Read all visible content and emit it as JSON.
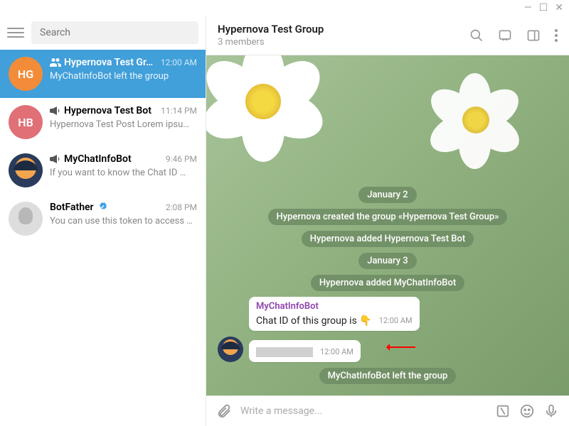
{
  "search": {
    "placeholder": "Search"
  },
  "chats": [
    {
      "name": "Hypernova Test Gr…",
      "time": "12:00 AM",
      "preview": "MyChatInfoBot left the group",
      "avatar_text": "HG"
    },
    {
      "name": "Hypernova Test Bot",
      "time": "11:14 PM",
      "preview": "Hypernova Test Post  Lorem ipsu…",
      "avatar_text": "HB"
    },
    {
      "name": "MyChatInfoBot",
      "time": "9:46 PM",
      "preview": "If you want to know the Chat ID …"
    },
    {
      "name": "BotFather",
      "time": "2:08 PM",
      "preview": "You can use this token to access …"
    }
  ],
  "header": {
    "title": "Hypernova Test Group",
    "sub": "3 members"
  },
  "timeline": {
    "date1": "January 2",
    "svc1": "Hypernova created the group «Hypernova Test Group»",
    "svc2": "Hypernova added Hypernova Test Bot",
    "date2": "January 3",
    "svc3": "Hypernova added MyChatInfoBot",
    "svc4": "MyChatInfoBot left the group"
  },
  "messages": [
    {
      "sender": "MyChatInfoBot",
      "text": "Chat ID of this group is 👇",
      "time": "12:00 AM"
    },
    {
      "text_redacted": true,
      "time": "12:00 AM"
    }
  ],
  "composer": {
    "placeholder": "Write a message..."
  }
}
